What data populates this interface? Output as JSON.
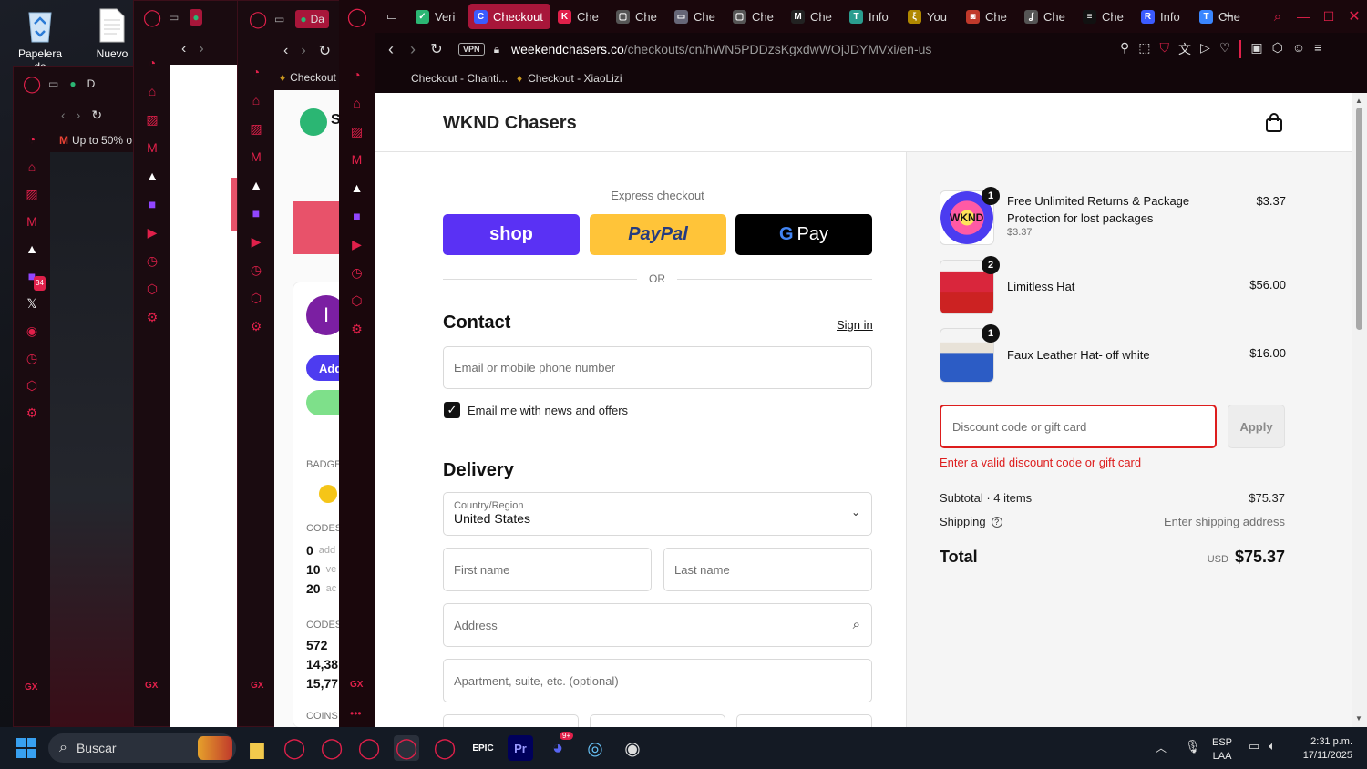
{
  "desktop": {
    "icons": [
      {
        "label": "Papelera de"
      },
      {
        "label": "Nuevo"
      }
    ]
  },
  "back_windows": {
    "win1": {
      "tab_label": "D",
      "bookmark": "Up to 50% o"
    },
    "win2": {
      "tab_label": "Da",
      "bookmark": "Checkout"
    },
    "win3": {
      "tab_label": "Da",
      "badges_label": "BADGE",
      "codes_label": "CODES",
      "codes_rows": [
        "0",
        "10",
        "20"
      ],
      "codes_values": [
        "add",
        "ve",
        "ac"
      ],
      "codes2_label": "CODES",
      "codes2_rows": [
        "572",
        "14,38",
        "15,77"
      ],
      "coins_label": "COINS",
      "add_button": "Add",
      "avatar_letter": "I",
      "logo_letter": "S",
      "gx_label": "GX"
    }
  },
  "browser": {
    "tabs": [
      {
        "label": "Veri",
        "color": "#2bb673",
        "glyph": "✓"
      },
      {
        "label": "Checkout",
        "color": "#3b5bff",
        "glyph": "C",
        "active": true
      },
      {
        "label": "Che",
        "color": "#e0204a",
        "glyph": "K"
      },
      {
        "label": "Che",
        "color": "#555",
        "glyph": "▢"
      },
      {
        "label": "Che",
        "color": "#667",
        "glyph": "▭"
      },
      {
        "label": "Che",
        "color": "#555",
        "glyph": "▢"
      },
      {
        "label": "Che",
        "color": "#222",
        "glyph": "M"
      },
      {
        "label": "Info",
        "color": "#2a9d8f",
        "glyph": "T"
      },
      {
        "label": "You",
        "color": "#b08800",
        "glyph": "ξ"
      },
      {
        "label": "Che",
        "color": "#c0392b",
        "glyph": "◙"
      },
      {
        "label": "Che",
        "color": "#555",
        "glyph": "ʆ"
      },
      {
        "label": "Che",
        "color": "#111",
        "glyph": "≡"
      },
      {
        "label": "Info",
        "color": "#3b5bff",
        "glyph": "R"
      },
      {
        "label": "Che",
        "color": "#3a86ff",
        "glyph": "T"
      }
    ],
    "vpn_label": "VPN",
    "url_domain": "weekendchasers.co",
    "url_path": "/checkouts/cn/hWN5PDDzsKgxdwWOjJDYMVxi/en-us",
    "bookmarks": [
      "Checkout - Chanti...",
      "Checkout - XiaoLizi"
    ],
    "gx_label": "GX"
  },
  "page": {
    "store_name": "WKND Chasers",
    "express_label": "Express checkout",
    "shop_label": "shop",
    "paypal_label": "PayPal",
    "gpay_label": "Pay",
    "or_label": "OR",
    "contact_heading": "Contact",
    "sign_in": "Sign in",
    "email_placeholder": "Email or mobile phone number",
    "news_label": "Email me with news and offers",
    "delivery_heading": "Delivery",
    "country_label": "Country/Region",
    "country_value": "United States",
    "first_name": "First name",
    "last_name": "Last name",
    "address": "Address",
    "apartment": "Apartment, suite, etc. (optional)"
  },
  "summary": {
    "items": [
      {
        "qty": "1",
        "name": "Free Unlimited Returns & Package Protection for lost packages",
        "sub": "$3.37",
        "price": "$3.37",
        "thumb_text": "WKND"
      },
      {
        "qty": "2",
        "name": "Limitless Hat",
        "sub": "",
        "price": "$56.00",
        "thumb_text": ""
      },
      {
        "qty": "1",
        "name": "Faux Leather Hat- off white",
        "sub": "",
        "price": "$16.00",
        "thumb_text": ""
      }
    ],
    "discount_placeholder": "Discount code or gift card",
    "apply_label": "Apply",
    "discount_error": "Enter a valid discount code or gift card",
    "subtotal_label": "Subtotal · 4 items",
    "subtotal_value": "$75.37",
    "shipping_label": "Shipping",
    "shipping_value": "Enter shipping address",
    "total_label": "Total",
    "currency": "USD",
    "total_value": "$75.37",
    "error_color": "#dd1d1d"
  },
  "taskbar": {
    "search_placeholder": "Buscar",
    "lang_top": "ESP",
    "lang_bottom": "LAA",
    "time": "2:31 p.m.",
    "date": "17/11/2025",
    "discord_badge": "9+",
    "twitch_badge": "34"
  }
}
